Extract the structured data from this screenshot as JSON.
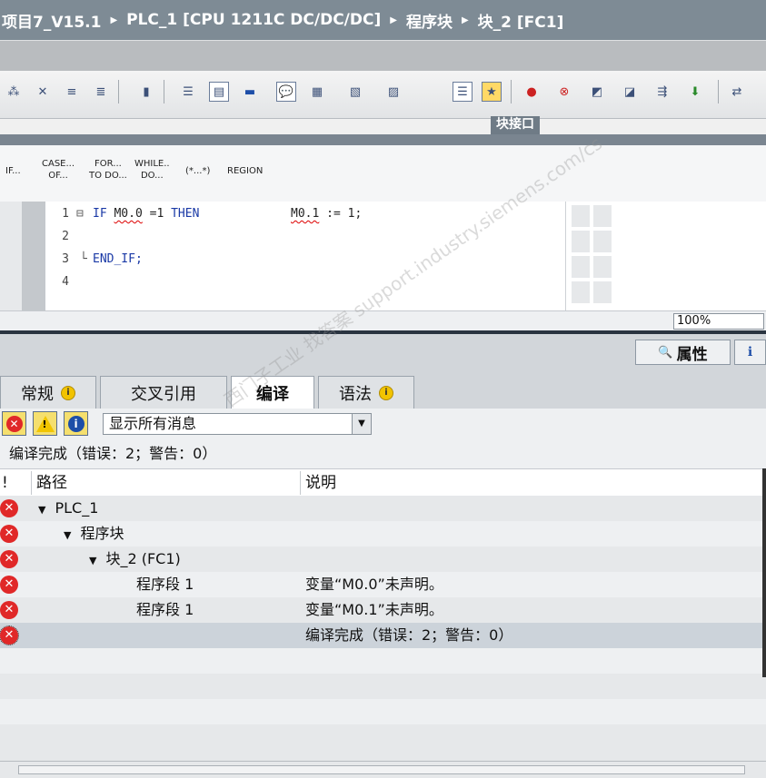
{
  "breadcrumb": {
    "items": [
      "项目7_V15.1",
      "PLC_1 [CPU 1211C DC/DC/DC]",
      "程序块",
      "块_2 [FC1]"
    ],
    "separator": "▶"
  },
  "editor": {
    "block_interface_label": "块接口",
    "keywords": [
      {
        "line1": "IF...",
        "line2": ""
      },
      {
        "line1": "CASE...",
        "line2": "OF..."
      },
      {
        "line1": "FOR...",
        "line2": "TO DO..."
      },
      {
        "line1": "WHILE..",
        "line2": "DO..."
      },
      {
        "line1": "(*...*)",
        "line2": ""
      },
      {
        "line1": "REGION",
        "line2": ""
      }
    ],
    "lines": [
      {
        "num": "1",
        "fold": "⊟"
      },
      {
        "num": "2",
        "fold": ""
      },
      {
        "num": "3",
        "fold": "└"
      },
      {
        "num": "4",
        "fold": ""
      }
    ],
    "code": {
      "if_kw": "IF",
      "var1": "M0.0",
      "cond": " =1",
      "then_kw": "THEN",
      "var2": "M0.1",
      "assign": " := 1;",
      "endif": "END_IF;"
    },
    "zoom": "100%"
  },
  "inspector": {
    "properties_label": "属性",
    "tabs": [
      {
        "label": "常规",
        "has_info": true,
        "active": false
      },
      {
        "label": "交叉引用",
        "has_info": false,
        "active": false
      },
      {
        "label": "编译",
        "has_info": false,
        "active": true
      },
      {
        "label": "语法",
        "has_info": true,
        "active": false
      }
    ],
    "filter": {
      "selected": "显示所有消息"
    },
    "summary": "编译完成（错误：2；警告：0）",
    "columns": {
      "flag": "!",
      "path": "路径",
      "desc": "说明"
    },
    "rows": [
      {
        "path": "PLC_1",
        "indent": 1,
        "expand": "▼",
        "desc": ""
      },
      {
        "path": "程序块",
        "indent": 2,
        "expand": "▼",
        "desc": ""
      },
      {
        "path": "块_2 (FC1)",
        "indent": 3,
        "expand": "▼",
        "desc": ""
      },
      {
        "path": "程序段 1",
        "indent": 4,
        "expand": "",
        "desc": "变量“M0.0”未声明。"
      },
      {
        "path": "程序段 1",
        "indent": 4,
        "expand": "",
        "desc": "变量“M0.1”未声明。"
      },
      {
        "path": "",
        "indent": 0,
        "expand": "",
        "desc": "编译完成（错误：2；警告：0）"
      }
    ]
  },
  "watermark": "西门子工业 找答案 support.industry.siemens.com/cs",
  "colors": {
    "titlebar": "#7e8b95",
    "keyword": "#1a39a6",
    "error": "#e02828",
    "warning": "#f1c500",
    "info": "#1d4ea8"
  }
}
